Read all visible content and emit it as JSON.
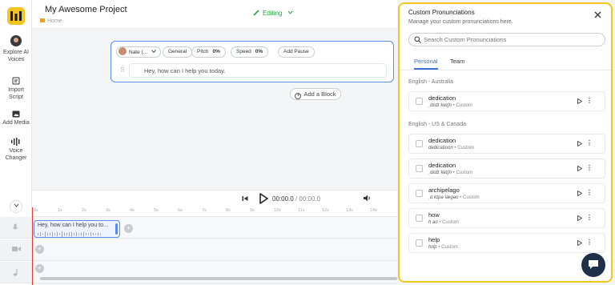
{
  "header": {
    "project_title": "My Awesome Project",
    "breadcrumb": "Home",
    "mode_label": "Editing"
  },
  "rail": {
    "items": [
      {
        "label_line1": "Explore AI",
        "label_line2": "Voices",
        "icon": "voice-avatar-icon"
      },
      {
        "label_line1": "Import",
        "label_line2": "Script",
        "icon": "import-icon"
      },
      {
        "label_line1": "Add Media",
        "label_line2": "",
        "icon": "media-icon"
      },
      {
        "label_line1": "Voice",
        "label_line2": "Changer",
        "icon": "voice-changer-icon"
      }
    ]
  },
  "editor": {
    "voice_name": "Nate (...",
    "style": "General",
    "pitch_label": "Pitch",
    "pitch_value": "0%",
    "speed_label": "Speed",
    "speed_value": "0%",
    "add_pause": "Add Pause",
    "text": "Hey, how can I help you today.",
    "add_block": "Add a Block"
  },
  "player": {
    "current_time": "00:00.0",
    "separator": " / ",
    "duration": "00:00.0"
  },
  "timeline": {
    "tick_labels": [
      "0s",
      "1s",
      "2s",
      "3s",
      "4s",
      "5s",
      "6s",
      "7s",
      "8s",
      "9s",
      "10s",
      "11s",
      "12s",
      "13s",
      "14s"
    ],
    "clip_text": "Hey, how can I help you to..."
  },
  "panel": {
    "title": "Custom Pronunciations",
    "subtitle": "Manage your custom pronunciations here.",
    "search_placeholder": "Search Custom Pronunciations",
    "tabs": [
      "Personal",
      "Team"
    ],
    "active_tab": "Personal",
    "groups": [
      {
        "name": "English - Australia",
        "entries": [
          {
            "word": "dedication",
            "ipa": "ˌdɛdɪˈkeɪʃn",
            "tag": "Custom"
          }
        ]
      },
      {
        "name": "English - US & Canada",
        "entries": [
          {
            "word": "dedication",
            "ipa": "dedicatioon",
            "tag": "Custom"
          },
          {
            "word": "dedication",
            "ipa": "ˌdɛdɪˈkeɪʃn",
            "tag": "Custom"
          },
          {
            "word": "archipelago",
            "ipa": "ˌɑːkɪpəˈlæɡəʊ",
            "tag": "Custom"
          },
          {
            "word": "how",
            "ipa": "h aʊ",
            "tag": "Custom"
          },
          {
            "word": "help",
            "ipa": "hɛlp",
            "tag": "Custom"
          }
        ]
      }
    ],
    "bullet": "•"
  },
  "colors": {
    "accent": "#3a6fd8",
    "panel_border": "#f5c518",
    "editing": "#2ea043",
    "playhead": "#e53935",
    "chat_fab": "#1f3148"
  }
}
